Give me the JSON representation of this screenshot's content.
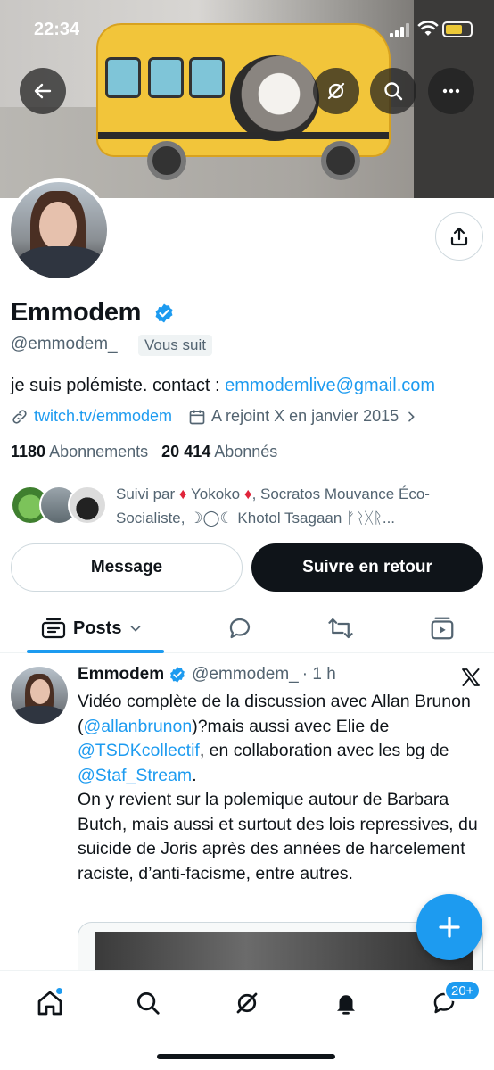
{
  "status_bar": {
    "time": "22:34"
  },
  "profile": {
    "name": "Emmodem",
    "handle": "@emmodem_",
    "follows_you": "Vous suit",
    "bio_text": "je suis polémiste. contact : ",
    "bio_email": "emmodemlive@gmail.com",
    "website": "twitch.tv/emmodem",
    "joined": "A rejoint X en janvier 2015",
    "following_count": "1180",
    "following_label": "Abonnements",
    "followers_count": "20 414",
    "followers_label": "Abonnés",
    "followed_by_prefix": "Suivi par ",
    "followed_by_text": "Yokoko",
    "followed_by_rest": ", Socratos Mouvance Éco-Socialiste, ☽◯☾ Khotol Tsagaan ᚠᚱᚷᚱ...",
    "diamond_glyph": "♦"
  },
  "actions": {
    "message": "Message",
    "follow_back": "Suivre en retour"
  },
  "tabs": {
    "posts": "Posts"
  },
  "tweet": {
    "name": "Emmodem",
    "handle": "@emmodem_",
    "time": "· 1 h",
    "p1_a": "Vidéo complète de la discussion avec Allan Brunon (",
    "p1_mention1": "@allanbrunon",
    "p1_b": ")?mais aussi avec Elie de ",
    "p1_mention2": "@TSDKcollectif",
    "p1_c": ", en collaboration avec les bg de ",
    "p1_mention3": "@Staf_Stream",
    "p1_d": ".",
    "p2": "On y revient sur la polemique autour de Barbara Butch, mais aussi et surtout des lois repressives, du suicide de Joris après des années de harcelement raciste, d’anti-facisme, entre autres."
  },
  "nav": {
    "messages_badge": "20+"
  },
  "colors": {
    "accent": "#1d9bf0",
    "text": "#0f1419",
    "muted": "#536471",
    "border": "#cfd9de"
  }
}
